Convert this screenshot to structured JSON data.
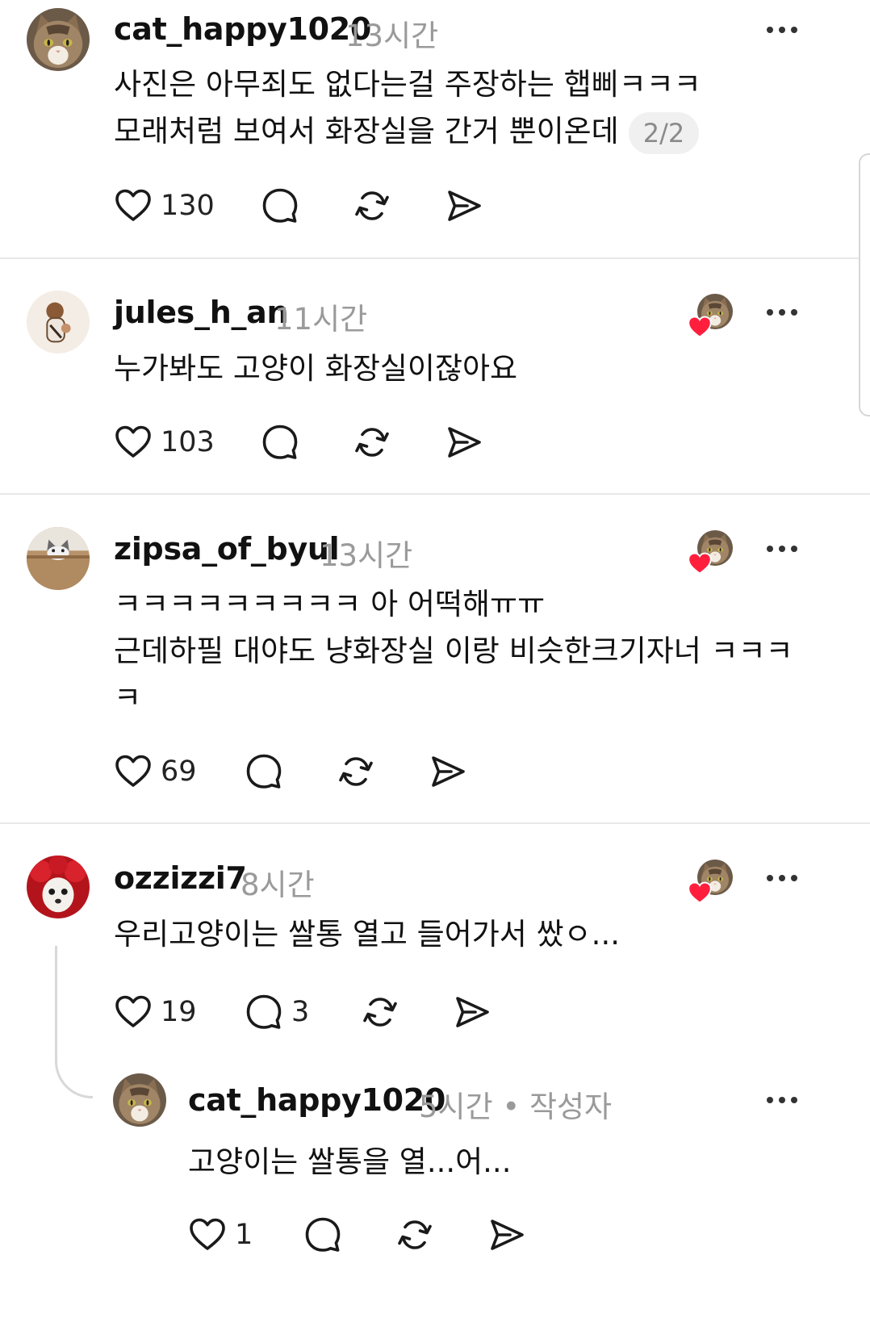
{
  "comments": [
    {
      "username": "cat_happy1020",
      "time": "13시간",
      "lines": [
        "사진은 아무죄도 없다는걸 주장하는 햅삐ㅋㅋㅋ",
        "모래처럼 보여서 화장실을 간거 뿐이온데"
      ],
      "pager": "2/2",
      "likes": "130",
      "replies": ""
    },
    {
      "username": "jules_h_an",
      "time": "11시간",
      "lines": [
        "누가봐도 고양이 화장실이잖아요"
      ],
      "likes": "103",
      "replies": ""
    },
    {
      "username": "zipsa_of_byul",
      "time": "13시간",
      "lines": [
        "ㅋㅋㅋㅋㅋㅋㅋㅋㅋ 아 어떡해ㅠㅠ",
        "근데하필 대야도 냥화장실 이랑 비슷한크기자너 ㅋㅋㅋ",
        "ㅋ"
      ],
      "likes": "69",
      "replies": ""
    },
    {
      "username": "ozzizzi7",
      "time": "8시간",
      "lines": [
        "우리고양이는 쌀통 열고 들어가서 쌌ㅇ..."
      ],
      "likes": "19",
      "replies": "3"
    },
    {
      "username": "cat_happy1020",
      "time": "5시간",
      "author_tag": "• 작성자",
      "lines": [
        "고양이는 쌀통을 열...어..."
      ],
      "likes": "1",
      "replies": ""
    }
  ],
  "icons": {
    "like": "heart-icon",
    "reply": "comment-bubble-icon",
    "repost": "repost-icon",
    "share": "send-icon",
    "more": "more-options-icon",
    "author_liked": "author-liked-heart-icon"
  },
  "colors": {
    "text": "#111111",
    "muted": "#9a9a9a",
    "heart": "#ff1f3d",
    "divider": "#e8e8e8"
  }
}
